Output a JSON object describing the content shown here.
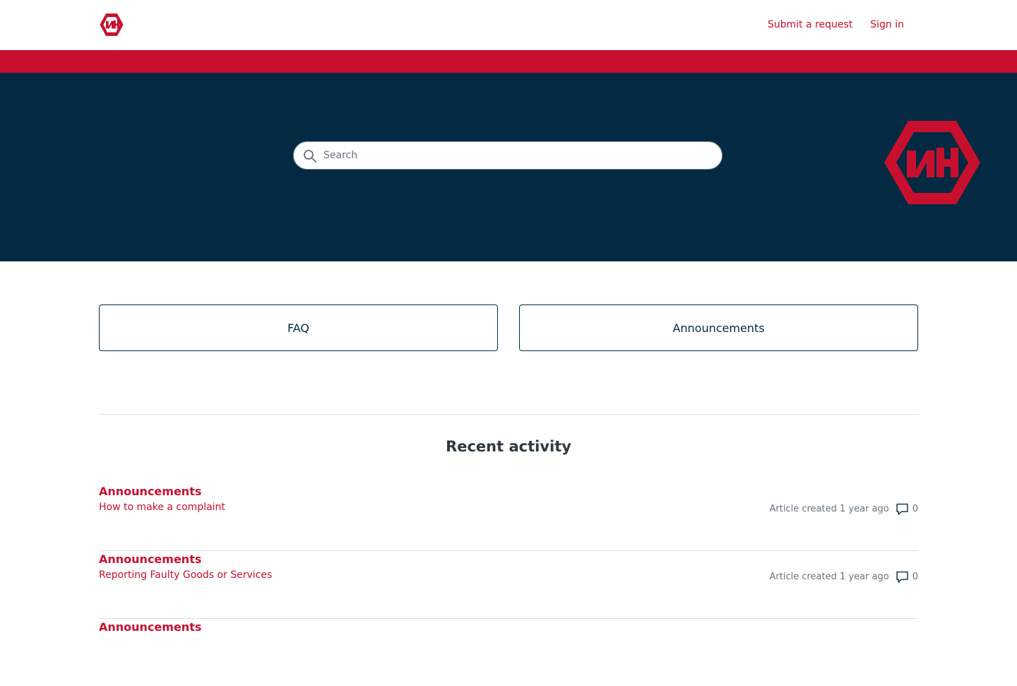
{
  "header": {
    "logo_text": "NH",
    "nav": [
      {
        "label": "Submit a request"
      },
      {
        "label": "Sign in"
      }
    ]
  },
  "hero": {
    "search": {
      "placeholder": "Search",
      "value": ""
    },
    "logo_text": "NH"
  },
  "blocks": [
    {
      "label": "FAQ"
    },
    {
      "label": "Announcements"
    }
  ],
  "recent_activity": {
    "title": "Recent activity",
    "items": [
      {
        "section": "Announcements",
        "article": "How to make a complaint",
        "meta": "Article created 1 year ago",
        "comments": "0"
      },
      {
        "section": "Announcements",
        "article": "Reporting Faulty Goods or Services",
        "meta": "Article created 1 year ago",
        "comments": "0"
      },
      {
        "section": "Announcements",
        "article": "",
        "meta": "",
        "comments": ""
      }
    ]
  },
  "colors": {
    "brand_red": "#c8102e",
    "navy": "#032a42"
  },
  "icons": {
    "search": "search-icon",
    "comment": "comment-icon",
    "logo": "brand-logo-icon"
  }
}
